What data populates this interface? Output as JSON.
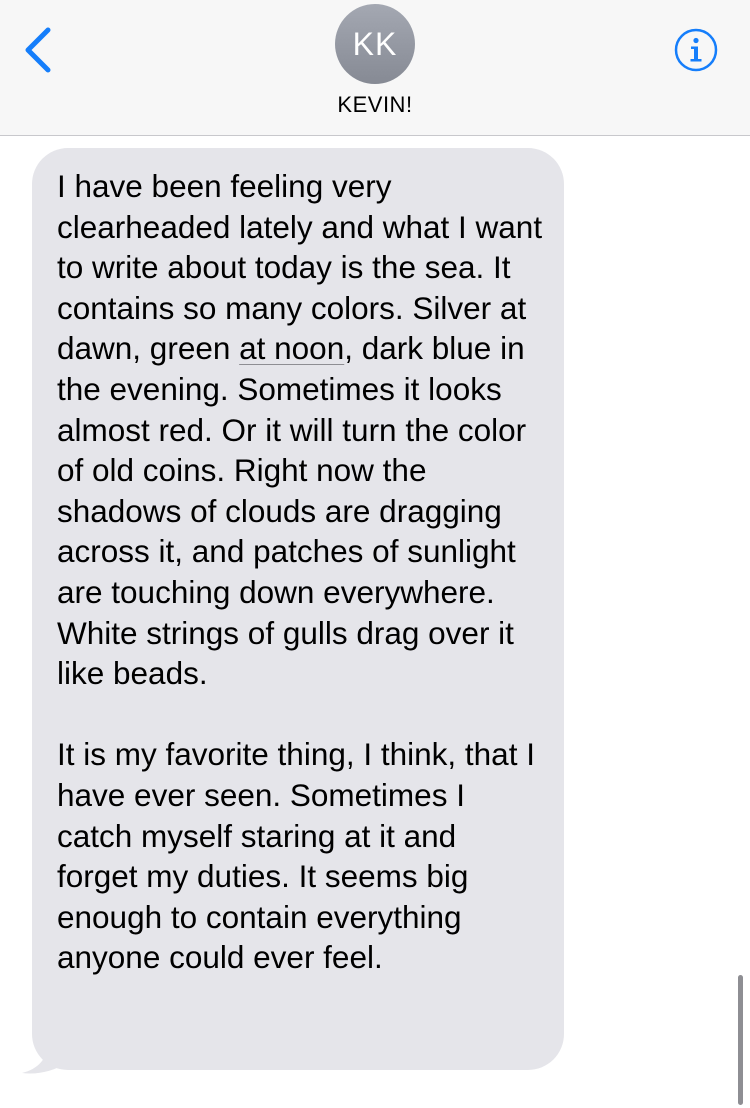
{
  "header": {
    "avatar_initials": "KK",
    "contact_name": "KEVIN!",
    "back_icon": "chevron-left-icon",
    "info_icon": "info-circle-icon",
    "accent_color": "#157efb"
  },
  "message": {
    "sender": "incoming",
    "bubble_color": "#e5e5ea",
    "text_before_link": "I have been feeling very clearheaded lately and what I want to write about today is the sea. It contains so many colors. Silver at dawn, green ",
    "link_text": "at noon",
    "text_after_link": ", dark blue in the evening. Sometimes it looks almost red. Or it will turn the color of old coins. Right now the shadows of clouds are dragging across it, and patches of sunlight are touching down everywhere. White strings of gulls drag over it like beads.\n\nIt is my favorite thing, I think, that I have ever seen. Sometimes I catch myself staring at it and forget my duties. It seems big enough to contain everything anyone could ever feel."
  }
}
